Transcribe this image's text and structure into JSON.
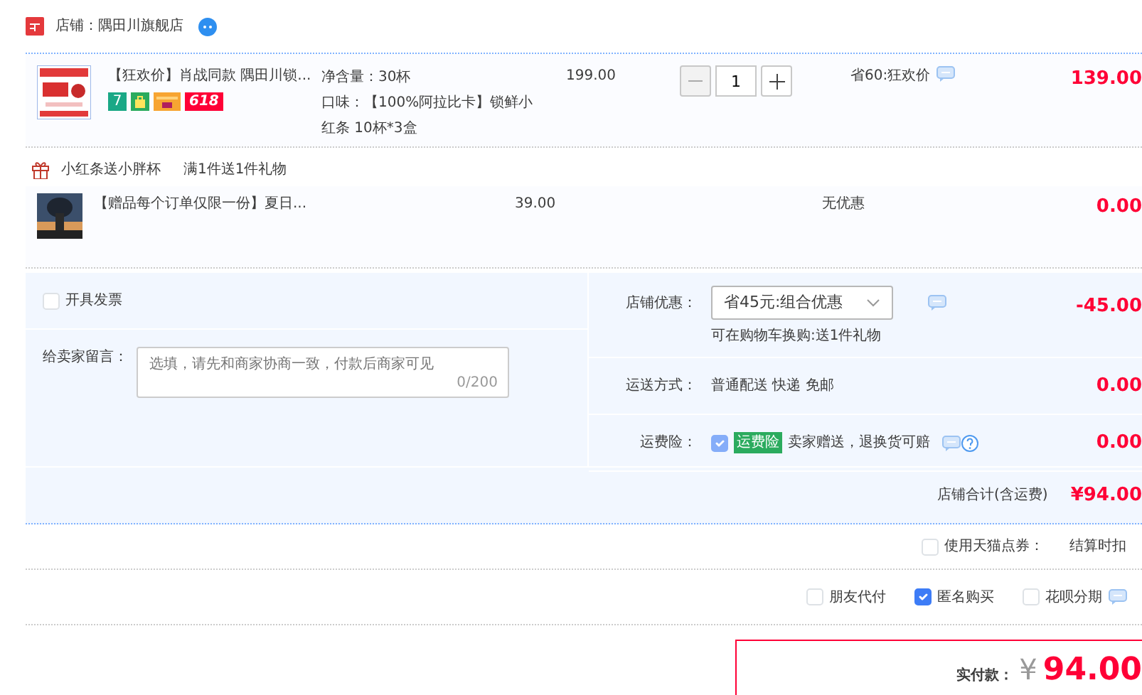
{
  "shop": {
    "title": "店铺：隅田川旗舰店"
  },
  "item": {
    "title": "【狂欢价】肖战同款 隅田川锁...",
    "badges": [
      {
        "kind": "number",
        "text": "7"
      },
      {
        "kind": "bag"
      },
      {
        "kind": "card"
      },
      {
        "kind": "sale",
        "text": "618"
      }
    ],
    "specs": [
      "净含量：30杯",
      "口味：【100%阿拉比卡】锁鲜小红条 10杯*3盒"
    ],
    "price": "199.00",
    "quantity": "1",
    "promo": "省60:狂欢价",
    "subtotal": "139.00"
  },
  "gift_group": {
    "name": "小红条送小胖杯",
    "rule": "满1件送1件礼物"
  },
  "gift_item": {
    "title": "【赠品每个订单仅限一份】夏日...",
    "price": "39.00",
    "promo": "无优惠",
    "subtotal": "0.00"
  },
  "invoice": {
    "label": "开具发票",
    "checked": false
  },
  "message": {
    "label": "给卖家留言：",
    "placeholder": "选填，请先和商家协商一致，付款后商家可见",
    "counter": "0/200"
  },
  "charges": [
    {
      "kind": "select",
      "label": "店铺优惠：",
      "value": "省45元:组合优惠",
      "note": "可在购物车换购:送1件礼物",
      "amount": "-45.00"
    },
    {
      "kind": "text",
      "label": "运送方式：",
      "value": "普通配送 快递 免邮",
      "amount": "0.00"
    },
    {
      "kind": "insurance",
      "label": "运费险：",
      "checked": true,
      "disabled": true,
      "tag": "运费险",
      "value": "卖家赠送，退换货可赔",
      "amount": "0.00"
    }
  ],
  "total": {
    "label": "店铺合计(含运费)",
    "amount": "¥94.00"
  },
  "points": {
    "label": "使用天猫点券：",
    "checked": false,
    "note": "结算时扣"
  },
  "pay_options": [
    {
      "label": "朋友代付",
      "checked": false
    },
    {
      "label": "匿名购买",
      "checked": true
    },
    {
      "label": "花呗分期",
      "checked": false
    }
  ],
  "payment": {
    "label": "实付款：",
    "currency": "¥",
    "amount": "94.00"
  }
}
